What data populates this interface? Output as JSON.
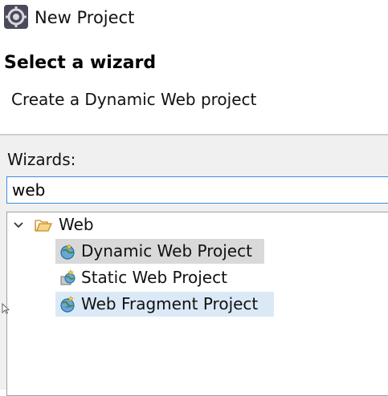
{
  "window": {
    "title": "New Project"
  },
  "header": {
    "heading": "Select a wizard",
    "description": "Create a Dynamic Web project"
  },
  "wizards": {
    "label": "Wizards:",
    "filter_value": "web"
  },
  "tree": {
    "category": {
      "label": "Web",
      "expanded": true
    },
    "items": [
      {
        "label": "Dynamic Web Project",
        "state": "selected"
      },
      {
        "label": "Static Web Project",
        "state": "normal"
      },
      {
        "label": "Web Fragment Project",
        "state": "hover"
      }
    ]
  },
  "colors": {
    "input_border": "#3c8ee3",
    "selected_bg": "#d9d9d9",
    "hover_bg": "#dbe9f7",
    "folder": "#e0a838"
  }
}
